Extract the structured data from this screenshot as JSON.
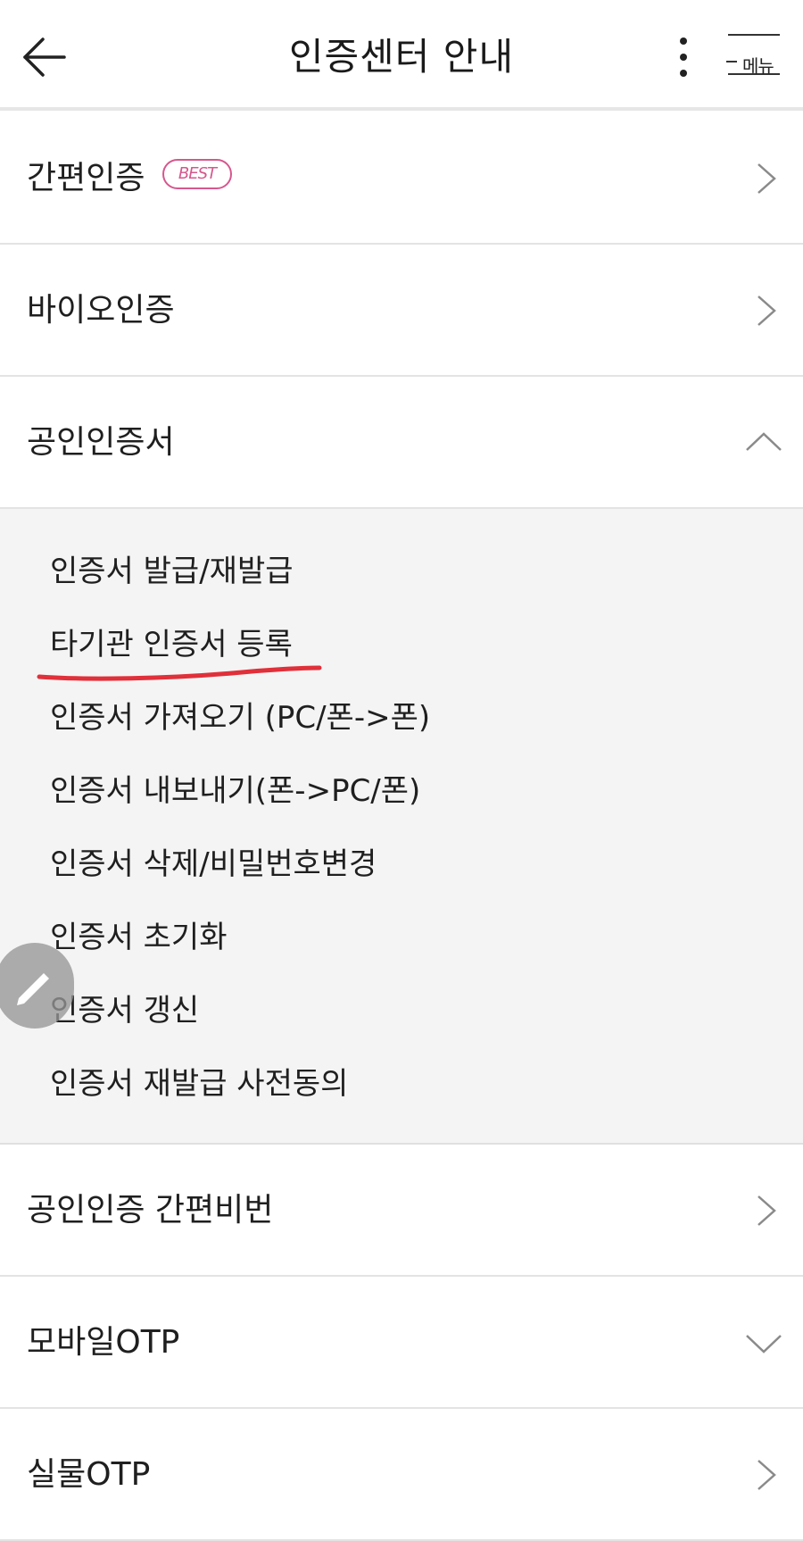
{
  "header": {
    "title": "인증센터 안내",
    "menu_label": "메뉴",
    "back_icon": "arrow-left-icon",
    "more_icon": "vertical-dots-icon",
    "menu_icon": "hamburger-icon"
  },
  "rows": [
    {
      "label": "간편인증",
      "badge": "BEST",
      "icon": "chevron-right-icon"
    },
    {
      "label": "바이오인증",
      "icon": "chevron-right-icon"
    },
    {
      "label": "공인인증서",
      "icon": "chevron-up-icon",
      "expanded": true
    },
    {
      "label": "공인인증 간편비번",
      "icon": "chevron-right-icon"
    },
    {
      "label": "모바일OTP",
      "icon": "chevron-down-icon"
    },
    {
      "label": "실물OTP",
      "icon": "chevron-right-icon"
    }
  ],
  "submenu": {
    "items": [
      "인증서 발급/재발급",
      "타기관 인증서 등록",
      "인증서 가져오기 (PC/폰->폰)",
      "인증서 내보내기(폰->PC/폰)",
      "인증서 삭제/비밀번호변경",
      "인증서 초기화",
      "인증서 갱신",
      "인증서 재발급 사전동의"
    ]
  },
  "fab": {
    "icon": "pencil-icon"
  },
  "colors": {
    "badge": "#d6578d",
    "annotation": "#e0303a",
    "submenu_bg": "#f4f4f4",
    "divider": "#e3e3e3"
  }
}
